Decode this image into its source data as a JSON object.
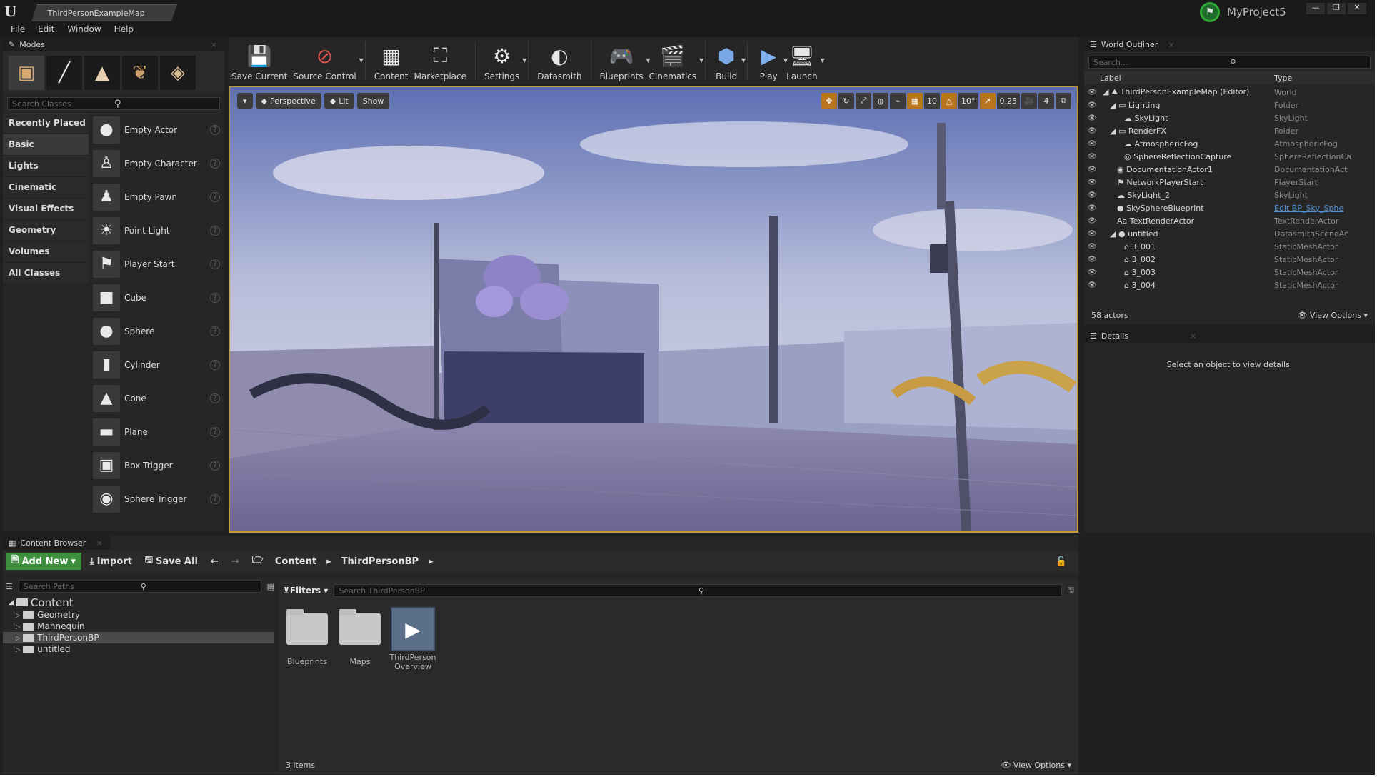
{
  "window": {
    "tab_title": "ThirdPersonExampleMap",
    "project_name": "MyProject5",
    "minimize": "—",
    "maximize": "❐",
    "close": "✕"
  },
  "menu": [
    "File",
    "Edit",
    "Window",
    "Help"
  ],
  "modes": {
    "tab": "Modes",
    "search_placeholder": "Search Classes",
    "categories": [
      "Recently Placed",
      "Basic",
      "Lights",
      "Cinematic",
      "Visual Effects",
      "Geometry",
      "Volumes",
      "All Classes"
    ],
    "selected_category": "Basic",
    "items": [
      "Empty Actor",
      "Empty Character",
      "Empty Pawn",
      "Point Light",
      "Player Start",
      "Cube",
      "Sphere",
      "Cylinder",
      "Cone",
      "Plane",
      "Box Trigger",
      "Sphere Trigger"
    ]
  },
  "toolbar": {
    "save_current": "Save Current",
    "source_control": "Source Control",
    "content": "Content",
    "marketplace": "Marketplace",
    "settings": "Settings",
    "datasmith": "Datasmith",
    "blueprints": "Blueprints",
    "cinematics": "Cinematics",
    "build": "Build",
    "play": "Play",
    "launch": "Launch"
  },
  "viewport": {
    "perspective": "Perspective",
    "lit": "Lit",
    "show": "Show",
    "grid_snap": "10",
    "rotation_snap": "10°",
    "scale_snap": "0.25",
    "camera_speed": "4"
  },
  "outliner": {
    "tab": "World Outliner",
    "search_placeholder": "Search...",
    "col_label": "Label",
    "col_type": "Type",
    "rows": [
      {
        "label": "ThirdPersonExampleMap (Editor)",
        "type": "World"
      },
      {
        "label": "Lighting",
        "type": "Folder"
      },
      {
        "label": "SkyLight",
        "type": "SkyLight"
      },
      {
        "label": "RenderFX",
        "type": "Folder"
      },
      {
        "label": "AtmosphericFog",
        "type": "AtmosphericFog"
      },
      {
        "label": "SphereReflectionCapture",
        "type": "SphereReflectionCa"
      },
      {
        "label": "DocumentationActor1",
        "type": "DocumentationAct"
      },
      {
        "label": "NetworkPlayerStart",
        "type": "PlayerStart"
      },
      {
        "label": "SkyLight_2",
        "type": "SkyLight"
      },
      {
        "label": "SkySphereBlueprint",
        "type": "Edit BP_Sky_Sphe"
      },
      {
        "label": "TextRenderActor",
        "type": "TextRenderActor"
      },
      {
        "label": "untitled",
        "type": "DatasmithSceneAc"
      },
      {
        "label": "3_001",
        "type": "StaticMeshActor"
      },
      {
        "label": "3_002",
        "type": "StaticMeshActor"
      },
      {
        "label": "3_003",
        "type": "StaticMeshActor"
      },
      {
        "label": "3_004",
        "type": "StaticMeshActor"
      }
    ],
    "actor_count": "58 actors",
    "view_options": "View Options"
  },
  "details": {
    "tab": "Details",
    "message": "Select an object to view details."
  },
  "content_browser": {
    "tab": "Content Browser",
    "add_new": "Add New",
    "import": "Import",
    "save_all": "Save All",
    "breadcrumb": [
      "Content",
      "ThirdPersonBP"
    ],
    "search_paths_placeholder": "Search Paths",
    "tree": {
      "root": "Content",
      "children": [
        "Geometry",
        "Mannequin",
        "ThirdPersonBP",
        "untitled"
      ],
      "selected": "ThirdPersonBP"
    },
    "filters": "Filters",
    "search_placeholder": "Search ThirdPersonBP",
    "assets": [
      {
        "name": "Blueprints"
      },
      {
        "name": "Maps"
      },
      {
        "name": "ThirdPerson Overview"
      }
    ],
    "item_count": "3 items",
    "view_options": "View Options"
  },
  "colors": {
    "accent_orange": "#c79a2d",
    "add_new_green": "#3d8f3d",
    "link_blue": "#4d8fd8"
  }
}
